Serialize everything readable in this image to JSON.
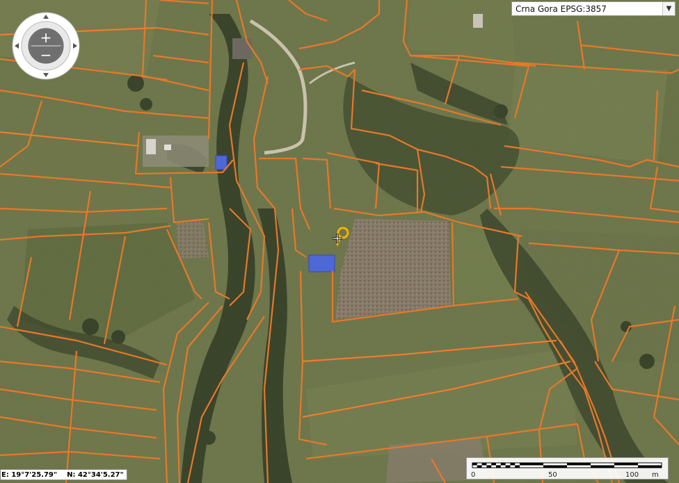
{
  "map": {
    "crs_selector": {
      "selected": "Crna Gora EPSG:3857"
    },
    "coordinates": {
      "easting": "E: 19°7'25.79\"",
      "northing": "N: 42°34'5.27\""
    },
    "scale": {
      "labels": [
        "0",
        "50",
        "100",
        "m"
      ]
    },
    "colors": {
      "parcel_border": "#e8782a",
      "field_green": "#6b7447",
      "forest_dark": "#2f3a22",
      "building_blue": "#4a64d8",
      "marker_yellow": "#f5b400"
    }
  }
}
